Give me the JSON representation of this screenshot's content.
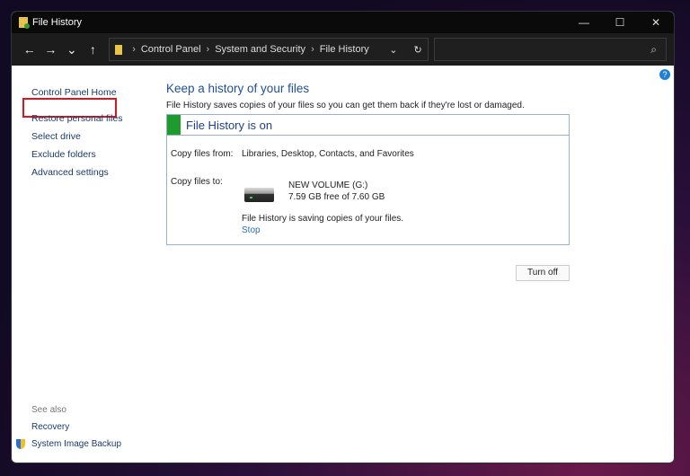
{
  "window": {
    "title": "File History",
    "minimize": "—",
    "maximize": "☐",
    "close": "✕"
  },
  "nav": {
    "back": "←",
    "forward": "→",
    "recent": "⌄",
    "up": "↑",
    "breadcrumb": [
      "Control Panel",
      "System and Security",
      "File History"
    ],
    "sep": "›",
    "dropdown": "⌄",
    "refresh": "↻",
    "search_icon": "⌕",
    "search_placeholder": ""
  },
  "sidebar": {
    "items": [
      {
        "label": "Control Panel Home"
      },
      {
        "label": "Restore personal files"
      },
      {
        "label": "Select drive"
      },
      {
        "label": "Exclude folders"
      },
      {
        "label": "Advanced settings"
      }
    ],
    "see_also": "See also",
    "links": [
      {
        "label": "Recovery"
      },
      {
        "label": "System Image Backup"
      }
    ]
  },
  "help": "?",
  "main": {
    "title": "Keep a history of your files",
    "description": "File History saves copies of your files so you can get them back if they're lost or damaged.",
    "status": "File History is on",
    "status_color": "#1e9a2e",
    "copy_from_label": "Copy files from:",
    "copy_from_value": "Libraries, Desktop, Contacts, and Favorites",
    "copy_to_label": "Copy files to:",
    "drive_name": "NEW VOLUME (G:)",
    "drive_space": "7.59 GB free of 7.60 GB",
    "saving_text": "File History is saving copies of your files.",
    "stop": "Stop",
    "turn_off": "Turn off"
  },
  "highlight_color": "#e0141e"
}
